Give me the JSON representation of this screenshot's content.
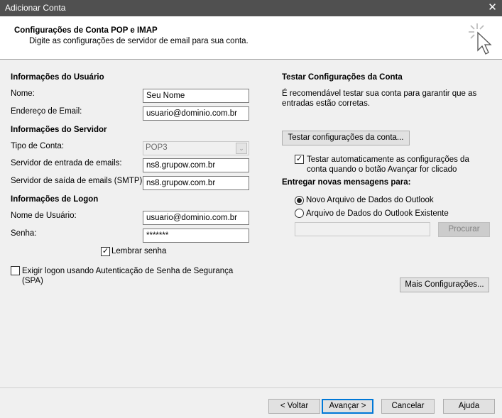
{
  "window": {
    "title": "Adicionar Conta",
    "close_glyph": "✕"
  },
  "header": {
    "title": "Configurações de Conta POP e IMAP",
    "subtitle": "Digite as configurações de servidor de email para sua conta."
  },
  "user_info": {
    "heading": "Informações do Usuário",
    "name_label": "Nome:",
    "name_value": "Seu Nome",
    "email_label": "Endereço de Email:",
    "email_value": "usuario@dominio.com.br"
  },
  "server_info": {
    "heading": "Informações do Servidor",
    "account_type_label": "Tipo de Conta:",
    "account_type_value": "POP3",
    "incoming_label": "Servidor de entrada de emails:",
    "incoming_value": "ns8.grupow.com.br",
    "outgoing_label": "Servidor de saída de emails (SMTP):",
    "outgoing_value": "ns8.grupow.com.br"
  },
  "logon_info": {
    "heading": "Informações de Logon",
    "username_label": "Nome de Usuário:",
    "username_value": "usuario@dominio.com.br",
    "password_label": "Senha:",
    "password_value": "*******",
    "remember_label": "Lembrar senha",
    "remember_checked": true,
    "spa_label": "Exigir logon usando Autenticação de Senha de Segurança (SPA)",
    "spa_checked": false
  },
  "test_settings": {
    "heading": "Testar Configurações da Conta",
    "description": "É recomendável testar sua conta para garantir que as entradas estão corretas.",
    "test_button": "Testar configurações da conta...",
    "auto_test_label": "Testar automaticamente as configurações da conta quando o botão Avançar for clicado",
    "auto_test_checked": true
  },
  "delivery": {
    "heading": "Entregar novas mensagens para:",
    "option_new": "Novo Arquivo de Dados do Outlook",
    "option_existing": "Arquivo de Dados do Outlook Existente",
    "selected": "new",
    "existing_path_value": "",
    "browse_button": "Procurar"
  },
  "more_settings_button": "Mais Configurações...",
  "footer": {
    "back": "< Voltar",
    "next": "Avançar >",
    "cancel": "Cancelar",
    "help": "Ajuda"
  },
  "colors": {
    "titlebar": "#505050",
    "primary_border": "#0078d7",
    "background": "#f0f0f0"
  },
  "icons": {
    "close": "close-icon",
    "wizard": "cursor-click-icon",
    "check": "check-icon",
    "dropdown": "chevron-down-icon"
  }
}
